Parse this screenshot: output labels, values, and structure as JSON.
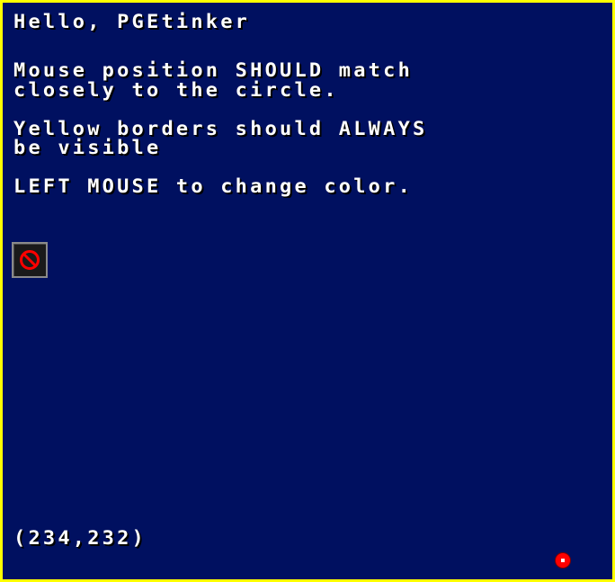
{
  "screen": {
    "background": "#001060",
    "border_color": "#ffff00"
  },
  "text": {
    "greeting": "Hello, PGEtinker",
    "mouse_line_1": "Mouse position SHOULD match",
    "mouse_line_2": "closely to the circle.",
    "border_line_1": "Yellow borders should ALWAYS",
    "border_line_2": "be visible",
    "instruction": "LEFT MOUSE to change color."
  },
  "mouse": {
    "coordinates_label": "(234,232)"
  },
  "tool_button": {
    "icon": "no-entry-icon",
    "icon_color": "#ff0000"
  },
  "circle": {
    "color": "#ff0000"
  }
}
